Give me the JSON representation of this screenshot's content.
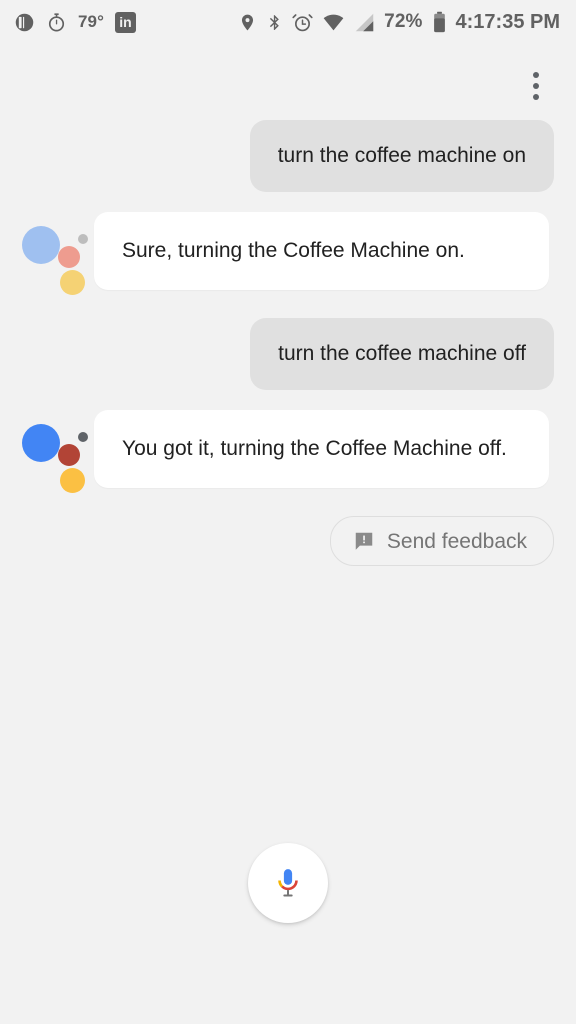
{
  "status_bar": {
    "left_icons": [
      {
        "name": "do-not-disturb-icon",
        "glyph": "dnd"
      },
      {
        "name": "stopwatch-icon",
        "glyph": "stopwatch"
      }
    ],
    "temperature": "79°",
    "linkedin_label": "in",
    "right_icons": [
      {
        "name": "location-pin-icon",
        "glyph": "pin"
      },
      {
        "name": "bluetooth-icon",
        "glyph": "bluetooth"
      },
      {
        "name": "alarm-clock-icon",
        "glyph": "alarm"
      },
      {
        "name": "wifi-icon",
        "glyph": "wifi"
      },
      {
        "name": "cellular-signal-icon",
        "glyph": "signal"
      }
    ],
    "battery_percent": "72%",
    "clock": "4:17:35 PM"
  },
  "header": {
    "overflow_menu_label": "More options"
  },
  "conversation": {
    "messages": [
      {
        "role": "user",
        "text": "turn the coffee machine on"
      },
      {
        "role": "assistant",
        "text": "Sure, turning the Coffee Machine on.",
        "avatar_colors": {
          "blue": "#9FC0F0",
          "red": "#EE9C8F",
          "gray": "#BDBDBD",
          "yellow": "#F5D274"
        }
      },
      {
        "role": "user",
        "text": "turn the coffee machine off"
      },
      {
        "role": "assistant",
        "text": "You got it, turning the Coffee Machine off.",
        "avatar_colors": {
          "blue": "#4285F4",
          "red": "#B24436",
          "gray": "#5F6368",
          "yellow": "#FBC043"
        }
      }
    ]
  },
  "feedback": {
    "label": "Send feedback",
    "icon": "feedback-icon"
  },
  "mic": {
    "label": "Voice input",
    "icon": "microphone-icon"
  },
  "colors": {
    "background": "#F2F2F2",
    "user_bubble": "#E0E0E0",
    "assistant_bubble": "#FFFFFF",
    "text_primary": "#212121",
    "text_secondary": "#757575",
    "status_icon": "#616161",
    "google_blue": "#4285F4",
    "google_red": "#DB4437",
    "google_yellow": "#F4B400",
    "google_green": "#0F9D58"
  }
}
